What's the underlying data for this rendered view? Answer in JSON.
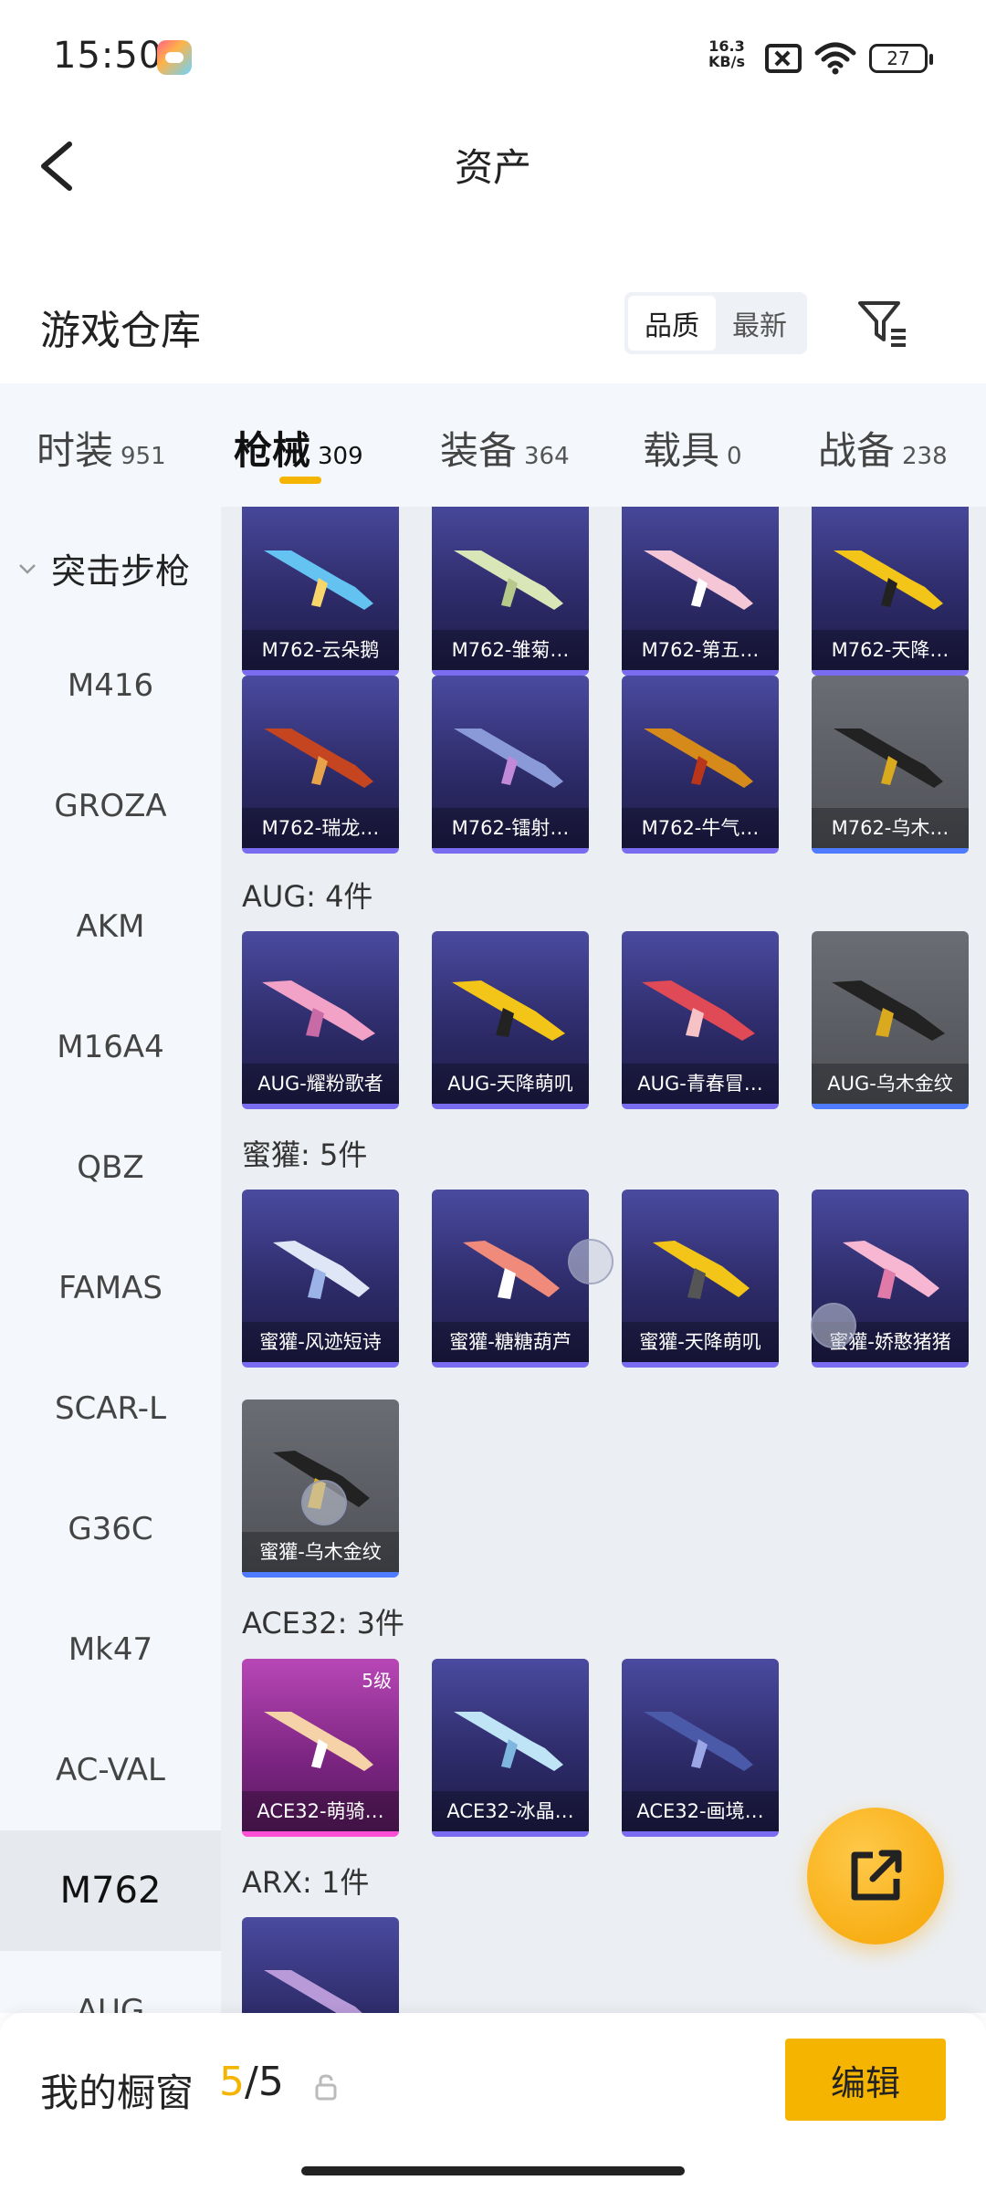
{
  "status": {
    "time": "15:50",
    "speed_value": "16.3",
    "speed_unit": "KB/s",
    "battery": "27"
  },
  "header": {
    "title": "资产"
  },
  "warehouse": {
    "title": "游戏仓库",
    "sort_options": [
      "品质",
      "最新"
    ],
    "sort_selected": "品质"
  },
  "tabs": [
    {
      "name": "时装",
      "count": "951"
    },
    {
      "name": "枪械",
      "count": "309"
    },
    {
      "name": "装备",
      "count": "364"
    },
    {
      "name": "载具",
      "count": "0"
    },
    {
      "name": "战备",
      "count": "238"
    }
  ],
  "active_tab": "枪械",
  "sidebar": {
    "group": "突击步枪",
    "items": [
      "M416",
      "GROZA",
      "AKM",
      "M16A4",
      "QBZ",
      "FAMAS",
      "SCAR-L",
      "G36C",
      "Mk47",
      "AC-VAL",
      "M762",
      "AUG"
    ],
    "active": "M762"
  },
  "sections": [
    {
      "title": "",
      "items": [
        {
          "label": "M762-云朵鹅",
          "style": "purple"
        },
        {
          "label": "M762-雏菊…",
          "style": "purple"
        },
        {
          "label": "M762-第五…",
          "style": "purple"
        },
        {
          "label": "M762-天降…",
          "style": "purple"
        },
        {
          "label": "M762-瑞龙…",
          "style": "purple"
        },
        {
          "label": "M762-镭射…",
          "style": "purple"
        },
        {
          "label": "M762-牛气…",
          "style": "purple"
        },
        {
          "label": "M762-乌木…",
          "style": "grey"
        }
      ]
    },
    {
      "title": "AUG: 4件",
      "items": [
        {
          "label": "AUG-耀粉歌者",
          "style": "purple"
        },
        {
          "label": "AUG-天降萌叽",
          "style": "purple"
        },
        {
          "label": "AUG-青春冒…",
          "style": "purple"
        },
        {
          "label": "AUG-乌木金纹",
          "style": "grey"
        }
      ]
    },
    {
      "title": "蜜獾: 5件",
      "items": [
        {
          "label": "蜜獾-风迹短诗",
          "style": "purple"
        },
        {
          "label": "蜜獾-糖糖葫芦",
          "style": "purple"
        },
        {
          "label": "蜜獾-天降萌叽",
          "style": "purple"
        },
        {
          "label": "蜜獾-娇憨猪猪",
          "style": "purple"
        },
        {
          "label": "蜜獾-乌木金纹",
          "style": "grey"
        }
      ]
    },
    {
      "title": "ACE32: 3件",
      "items": [
        {
          "label": "ACE32-萌骑…",
          "style": "pink",
          "level": "5级"
        },
        {
          "label": "ACE32-冰晶…",
          "style": "purple"
        },
        {
          "label": "ACE32-画境…",
          "style": "purple"
        }
      ]
    },
    {
      "title": "ARX: 1件",
      "items": [
        {
          "label": "",
          "style": "purple"
        }
      ]
    }
  ],
  "bottom": {
    "showcase_label": "我的橱窗",
    "showcase_current": "5",
    "showcase_total": "/5",
    "edit_label": "编辑"
  },
  "colors": {
    "accent": "#f5b400",
    "card_purple": "#2e2c6a",
    "card_grey": "#5a5c62",
    "card_pink": "#9a2ea0"
  }
}
